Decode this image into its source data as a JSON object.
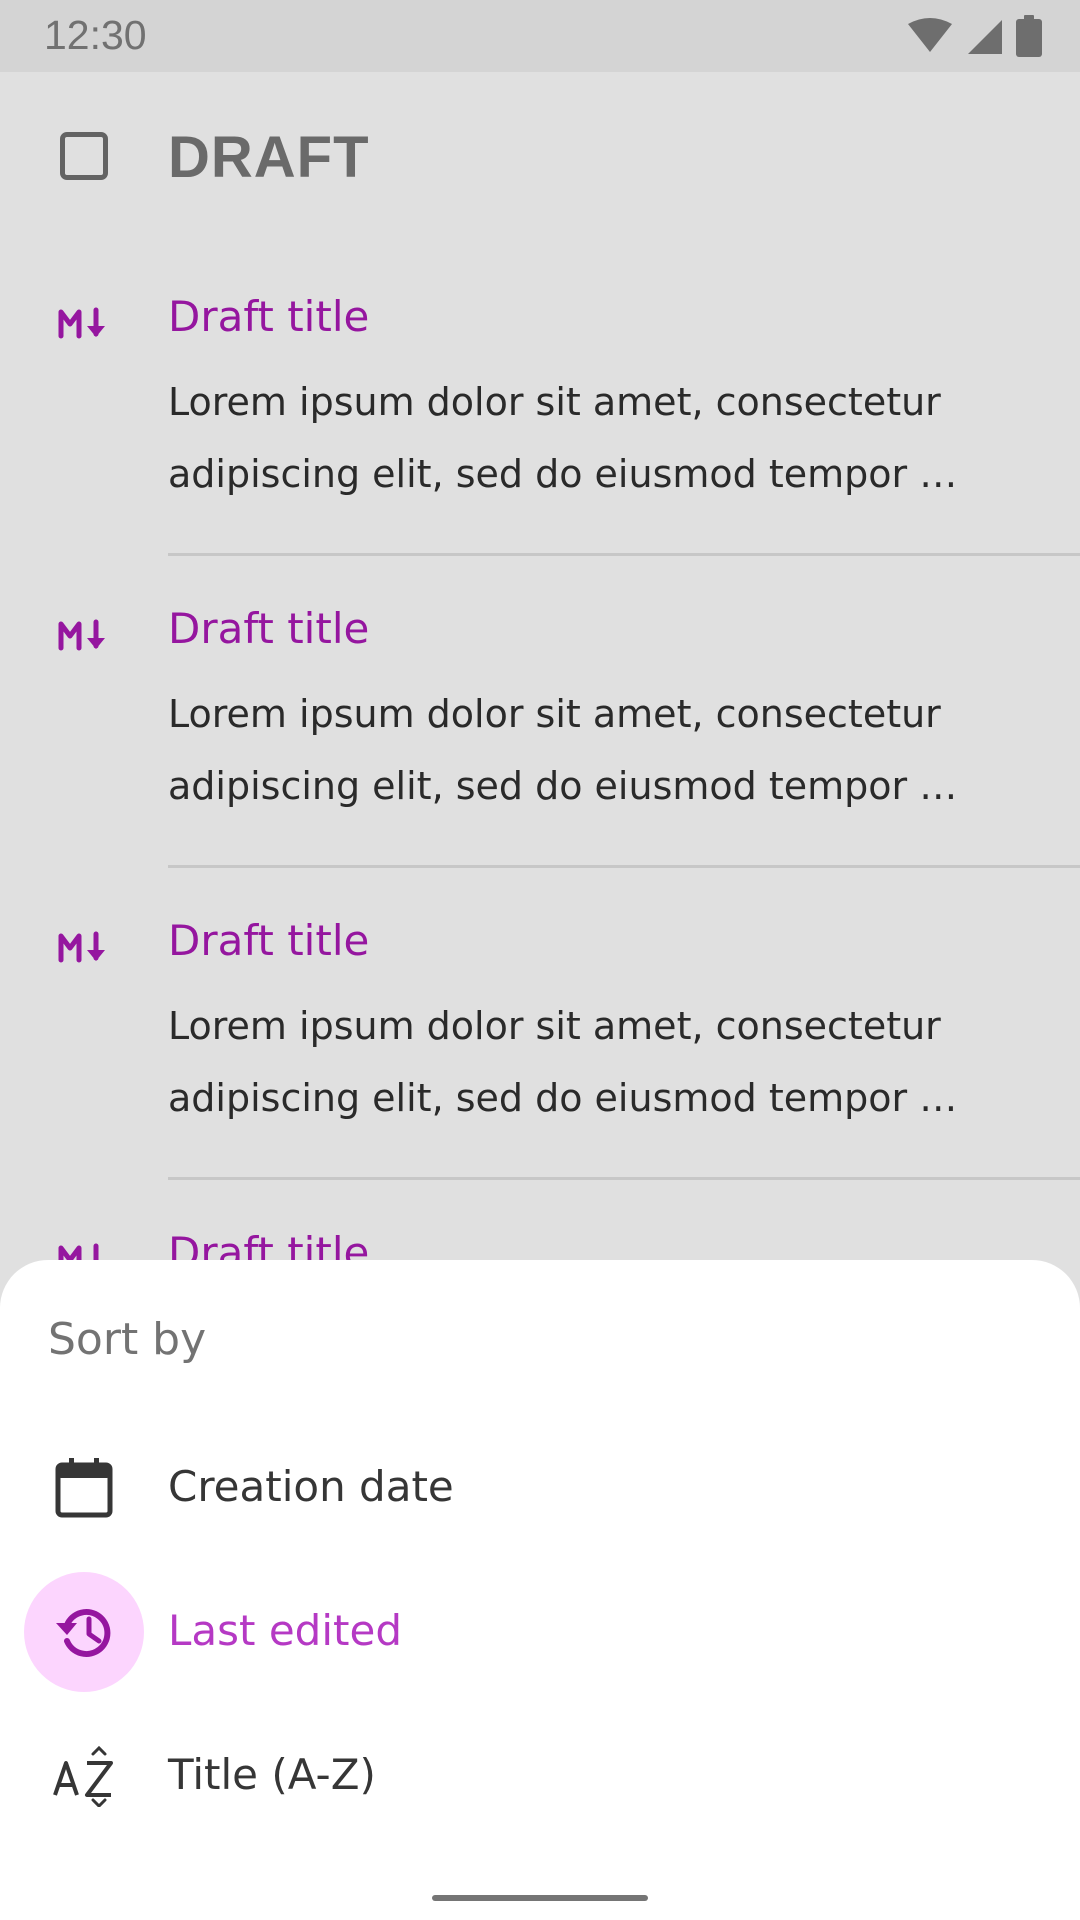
{
  "status_bar": {
    "time": "12:30",
    "icons": [
      "wifi-icon",
      "cell-signal-icon",
      "battery-icon"
    ]
  },
  "app_bar": {
    "title": "DRAFT",
    "select_all_icon": "checkbox-outline-icon"
  },
  "drafts": [
    {
      "icon": "markdown-icon",
      "title": "Draft title",
      "line1": "Lorem ipsum dolor sit amet, consectetur",
      "line2": "adipiscing elit, sed do eiusmod tempor …"
    },
    {
      "icon": "markdown-icon",
      "title": "Draft title",
      "line1": "Lorem ipsum dolor sit amet, consectetur",
      "line2": "adipiscing elit, sed do eiusmod tempor …"
    },
    {
      "icon": "markdown-icon",
      "title": "Draft title",
      "line1": "Lorem ipsum dolor sit amet, consectetur",
      "line2": "adipiscing elit, sed do eiusmod tempor …"
    },
    {
      "icon": "markdown-icon",
      "title": "Draft title",
      "line1": "",
      "line2": ""
    }
  ],
  "sort_sheet": {
    "title": "Sort by",
    "options": [
      {
        "label": "Creation date",
        "icon": "calendar-icon",
        "selected": false
      },
      {
        "label": "Last edited",
        "icon": "history-icon",
        "selected": true
      },
      {
        "label": "Title (A-Z)",
        "icon": "sort-alphabetical-icon",
        "selected": false
      }
    ]
  },
  "colors": {
    "accent": "#95169f",
    "selected_label": "#b539c4",
    "selected_bg": "#fcd5fe",
    "scrim_bg": "#e0e0e0"
  }
}
